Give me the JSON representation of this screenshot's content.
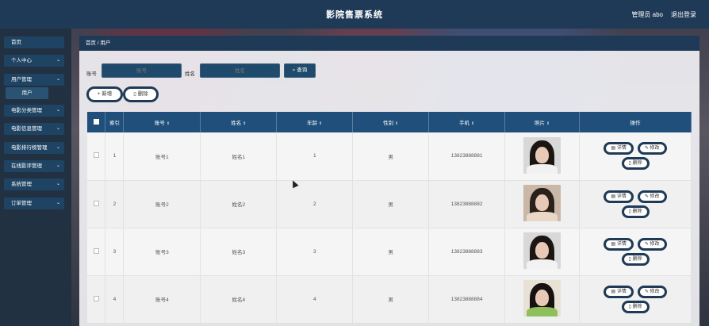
{
  "header": {
    "title": "影院售票系统",
    "admin": "管理员 abo",
    "logout": "退出登录"
  },
  "sidebar": {
    "items": [
      {
        "label": "首页",
        "chevron": false
      },
      {
        "label": "个人中心",
        "chevron": true
      },
      {
        "label": "用户管理",
        "chevron": true
      },
      {
        "label": "用户",
        "chevron": false
      },
      {
        "label": "电影分类管理",
        "chevron": true
      },
      {
        "label": "电影信息管理",
        "chevron": true
      },
      {
        "label": "电影排行榜管理",
        "chevron": true
      },
      {
        "label": "在线影评管理",
        "chevron": true
      },
      {
        "label": "系统管理",
        "chevron": true
      },
      {
        "label": "订单管理",
        "chevron": true
      }
    ]
  },
  "breadcrumb": "首页 / 用户",
  "search": {
    "account_label": "账号",
    "account_placeholder": "账号",
    "name_label": "姓名",
    "name_placeholder": "姓名",
    "query_button": "查询"
  },
  "actions": {
    "add": "新增",
    "delete": "删除"
  },
  "table": {
    "headers": [
      "索引",
      "账号",
      "姓名",
      "年龄",
      "性别",
      "手机",
      "照片",
      "操作"
    ],
    "rows": [
      {
        "index": "1",
        "account": "账号1",
        "name": "姓名1",
        "age": "1",
        "gender": "男",
        "phone": "13823888881"
      },
      {
        "index": "2",
        "account": "账号2",
        "name": "姓名2",
        "age": "2",
        "gender": "男",
        "phone": "13823888882"
      },
      {
        "index": "3",
        "account": "账号3",
        "name": "姓名3",
        "age": "3",
        "gender": "男",
        "phone": "13823888883"
      },
      {
        "index": "4",
        "account": "账号4",
        "name": "姓名4",
        "age": "4",
        "gender": "男",
        "phone": "13823888884"
      }
    ],
    "row_ops": {
      "detail": "详情",
      "edit": "修改",
      "delete": "删除"
    }
  },
  "icons": {
    "sort": "sort-icon",
    "chevron": "chevron-down-icon",
    "search": "search-icon",
    "add": "plus-icon",
    "trash": "trash-icon",
    "detail": "document-icon",
    "edit": "pencil-icon"
  }
}
